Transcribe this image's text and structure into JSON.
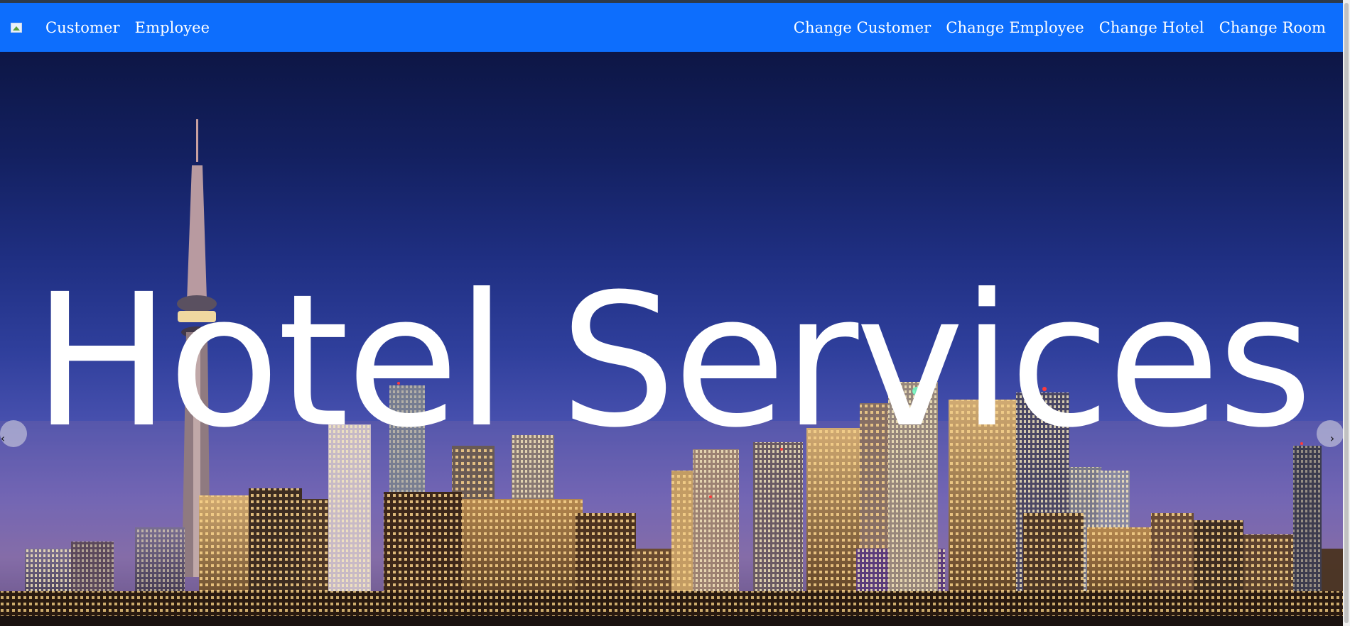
{
  "navbar": {
    "brand_icon": "broken-image-icon",
    "color": "#0d6efd",
    "left_links": [
      {
        "label": "Customer"
      },
      {
        "label": "Employee"
      }
    ],
    "right_links": [
      {
        "label": "Change Customer"
      },
      {
        "label": "Change Employee"
      },
      {
        "label": "Change Hotel"
      },
      {
        "label": "Change Room"
      }
    ]
  },
  "hero": {
    "title": "Hotel Services",
    "prev_symbol": "‹",
    "next_symbol": "›"
  }
}
